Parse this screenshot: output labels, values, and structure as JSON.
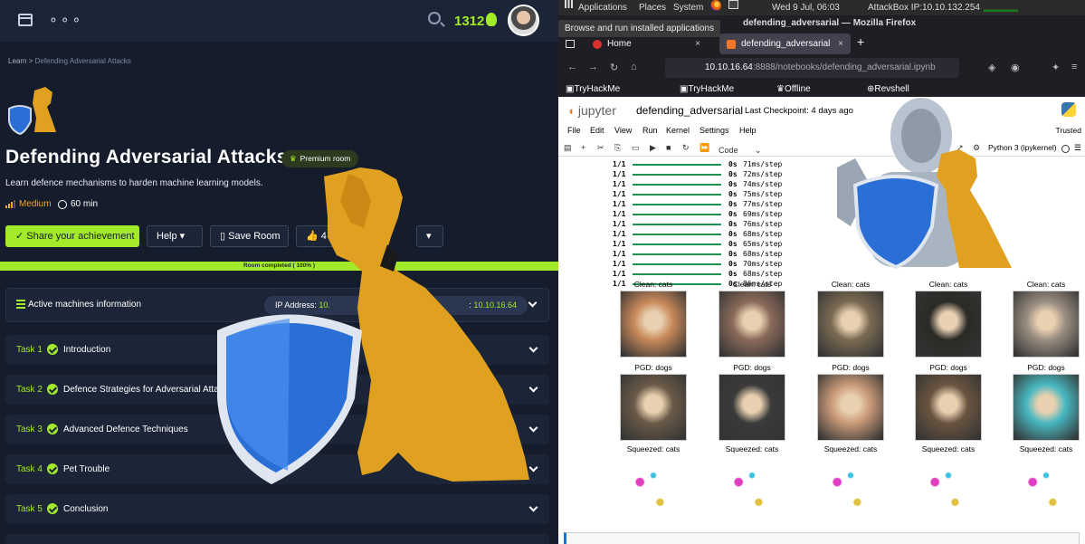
{
  "thm": {
    "points": "1312",
    "breadcrumb": {
      "root": "Learn",
      "sep": ">",
      "current": "Defending Adversarial Attacks"
    },
    "room": {
      "title": "Defending Adversarial Attacks",
      "premium_label": "Premium room",
      "description": "Learn defence mechanisms to harden machine learning models.",
      "difficulty": "Medium",
      "duration": "60 min"
    },
    "buttons": {
      "share": "Share your achievement",
      "help": "Help",
      "save": "Save Room",
      "likes": "4"
    },
    "progress_text": "Room completed ( 100% )",
    "progress_value": 1.0,
    "machines": {
      "label": "Active machines information",
      "ip_label": "IP Address:",
      "ip_partial": "10.",
      "ip_suffix_label": ":",
      "ip_value": "10.10.16.64"
    },
    "tasks": [
      {
        "num": "Task 1",
        "name": "Introduction"
      },
      {
        "num": "Task 2",
        "name": "Defence Strategies for Adversarial Attack"
      },
      {
        "num": "Task 3",
        "name": "Advanced Defence Techniques"
      },
      {
        "num": "Task 4",
        "name": "Pet Trouble"
      },
      {
        "num": "Task 5",
        "name": "Conclusion"
      }
    ],
    "colors": {
      "accent": "#a3ea2a",
      "bg": "#151c2b",
      "panel": "#1c2538",
      "difficulty": "#f5a623"
    }
  },
  "desktop": {
    "menu": [
      "Applications",
      "Places",
      "System"
    ],
    "clock": "Wed  9 Jul, 06:03",
    "attackbox_ip": "AttackBox IP:10.10.132.254",
    "tooltip": "Browse and run installed applications",
    "window_title": "defending_adversarial — Mozilla Firefox"
  },
  "firefox": {
    "tabs": [
      "Home",
      "defending_adversarial"
    ],
    "url_host": "10.10.16.64",
    "url_path": ":8888/notebooks/defending_adversarial.ipynb",
    "bookmarks": [
      "TryHackMe | Learn Cy...",
      "TryHackMe Support",
      "Offline CyberChef",
      "Revshell Generator"
    ]
  },
  "jupyter": {
    "logo": "jupyter",
    "notebook_name": "defending_adversarial",
    "checkpoint": "Last Checkpoint: 4 days ago",
    "menu": [
      "File",
      "Edit",
      "View",
      "Run",
      "Kernel",
      "Settings",
      "Help"
    ],
    "trusted": "Trusted",
    "cell_type": "Code",
    "lab_link": "rLab",
    "kernel": "Python 3 (ipykernel)",
    "output_lines": [
      {
        "frac": "1/1",
        "secs": "0s",
        "step": "71ms/step"
      },
      {
        "frac": "1/1",
        "secs": "0s",
        "step": "72ms/step"
      },
      {
        "frac": "1/1",
        "secs": "0s",
        "step": "74ms/step"
      },
      {
        "frac": "1/1",
        "secs": "0s",
        "step": "75ms/step"
      },
      {
        "frac": "1/1",
        "secs": "0s",
        "step": "77ms/step"
      },
      {
        "frac": "1/1",
        "secs": "0s",
        "step": "69ms/step"
      },
      {
        "frac": "1/1",
        "secs": "0s",
        "step": "76ms/step"
      },
      {
        "frac": "1/1",
        "secs": "0s",
        "step": "68ms/step"
      },
      {
        "frac": "1/1",
        "secs": "0s",
        "step": "65ms/step"
      },
      {
        "frac": "1/1",
        "secs": "0s",
        "step": "68ms/step"
      },
      {
        "frac": "1/1",
        "secs": "0s",
        "step": "70ms/step"
      },
      {
        "frac": "1/1",
        "secs": "0s",
        "step": "68ms/step"
      },
      {
        "frac": "1/1",
        "secs": "0s",
        "step": "86ms/step"
      }
    ],
    "clean": [
      "Clean: cats",
      "Clean: cats",
      "Clean: cats",
      "Clean: cats",
      "Clean: cats"
    ],
    "pgd": [
      "PGD: dogs",
      "PGD: dogs",
      "PGD: dogs",
      "PGD: dogs",
      "PGD: dogs"
    ],
    "squeezed": [
      "Squeezed: cats",
      "Squeezed: cats",
      "Squeezed: cats",
      "Squeezed: cats",
      "Squeezed: cats"
    ]
  }
}
